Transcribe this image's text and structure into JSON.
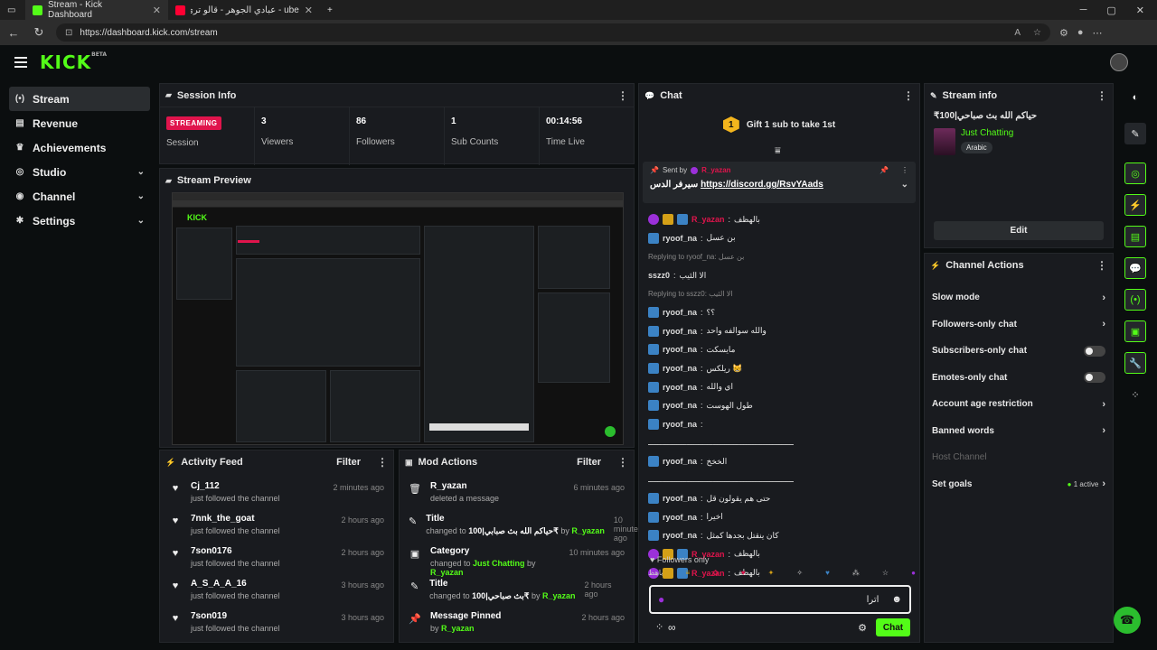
{
  "browser": {
    "tabs": [
      {
        "label": "Stream - Kick Dashboard",
        "color": "#53fc18"
      },
      {
        "label": "ube - عبادي الجوهر - قالو ترى (710)",
        "color": "#ff0033"
      }
    ],
    "url": "https://dashboard.kick.com/stream",
    "new_tab": "+",
    "win_controls": [
      "─",
      "▢",
      "✕"
    ]
  },
  "logo": {
    "text": "KICK",
    "beta": "BETA"
  },
  "sidebar": {
    "items": [
      {
        "label": "Stream",
        "icon": "stream-icon",
        "glyph": "(•)"
      },
      {
        "label": "Revenue",
        "icon": "revenue-icon",
        "glyph": "▤"
      },
      {
        "label": "Achievements",
        "icon": "trophy-icon",
        "glyph": "♛"
      },
      {
        "label": "Studio",
        "icon": "studio-icon",
        "glyph": "◎",
        "chev": "⌄"
      },
      {
        "label": "Channel",
        "icon": "channel-icon",
        "glyph": "◉",
        "chev": "⌄"
      },
      {
        "label": "Settings",
        "icon": "gear-icon",
        "glyph": "✱",
        "chev": "⌄"
      }
    ]
  },
  "session": {
    "title": "Session Info",
    "status_badge": "STREAMING",
    "status_label": "Session",
    "stats": [
      {
        "value": "3",
        "label": "Viewers"
      },
      {
        "value": "86",
        "label": "Followers"
      },
      {
        "value": "1",
        "label": "Sub Counts"
      },
      {
        "value": "00:14:56",
        "label": "Time Live"
      }
    ]
  },
  "preview": {
    "title": "Stream Preview",
    "logo": "KICK"
  },
  "activity": {
    "title": "Activity Feed",
    "filter": "Filter",
    "items": [
      {
        "name": "Cj_112",
        "desc": "just followed the channel",
        "time": "2 minutes ago"
      },
      {
        "name": "7nnk_the_goat",
        "desc": "just followed the channel",
        "time": "2 hours ago"
      },
      {
        "name": "7son0176",
        "desc": "just followed the channel",
        "time": "2 hours ago"
      },
      {
        "name": "A_S_A_A_16",
        "desc": "just followed the channel",
        "time": "3 hours ago"
      },
      {
        "name": "7son019",
        "desc": "just followed the channel",
        "time": "3 hours ago"
      }
    ]
  },
  "mod": {
    "title": "Mod Actions",
    "filter": "Filter",
    "items": [
      {
        "name": "R_yazan",
        "pre": "deleted a message",
        "hl": "",
        "mid": "",
        "by": "",
        "time": "6 minutes ago",
        "icon": "trash-icon",
        "glyph": "🗑"
      },
      {
        "name": "Title",
        "pre": "changed to ",
        "hl": "حياكم الله بث صبابي|100₹",
        "mid": " by ",
        "by": "R_yazan",
        "time": "10 minutes ago",
        "icon": "edit-title-icon",
        "glyph": "✎"
      },
      {
        "name": "Category",
        "pre": "changed to ",
        "hl": "Just Chatting",
        "mid": " by ",
        "by": "R_yazan",
        "time": "10 minutes ago",
        "icon": "category-icon",
        "glyph": "▣"
      },
      {
        "name": "Title",
        "pre": "changed to ",
        "hl": "بث صباحي|100₹",
        "mid": " by ",
        "by": "R_yazan",
        "time": "2 hours ago",
        "icon": "edit-title-icon",
        "glyph": "✎"
      },
      {
        "name": "Message Pinned",
        "pre": "by ",
        "hl": "R_yazan",
        "mid": "",
        "by": "",
        "time": "2 hours ago",
        "icon": "pin-icon",
        "glyph": "📌"
      }
    ]
  },
  "chat": {
    "title": "Chat",
    "gift_num": "1",
    "gift_text": "Gift 1 sub to take 1st",
    "pinned_by": "Sent by",
    "pinned_user": "R_yazan",
    "pinned_msg": "سيرفر الدس",
    "pinned_link": "https://discord.gg/RsvYAads",
    "messages": [
      {
        "user": "R_yazan",
        "text": "بالهظف",
        "badges": [
          "purple",
          "gold",
          "blue"
        ],
        "red": true
      },
      {
        "user": "ryoof_na",
        "text": "بن عسل",
        "badges": [
          "blue"
        ],
        "red": false
      },
      {
        "reply": "Replying to ryoof_na: بن عسل"
      },
      {
        "user": "sszz0",
        "text": "الا الئيب",
        "badges": [],
        "red": false
      },
      {
        "reply": "Replying to sszz0: الا الئيب"
      },
      {
        "user": "ryoof_na",
        "text": "؟؟",
        "badges": [
          "blue"
        ],
        "red": false
      },
      {
        "user": "ryoof_na",
        "text": "والله سوالفه واحد",
        "badges": [
          "blue"
        ],
        "red": false
      },
      {
        "user": "ryoof_na",
        "text": "مايسكت",
        "badges": [
          "blue"
        ],
        "red": false
      },
      {
        "user": "ryoof_na",
        "text": "ريلكس 😸",
        "badges": [
          "blue"
        ],
        "red": false
      },
      {
        "user": "ryoof_na",
        "text": "اي والله",
        "badges": [
          "blue"
        ],
        "red": false
      },
      {
        "user": "ryoof_na",
        "text": "طول الهوست",
        "badges": [
          "blue"
        ],
        "red": false
      },
      {
        "user": "ryoof_na",
        "text": "",
        "badges": [
          "blue"
        ],
        "red": false
      },
      {
        "line": "ـــــــــــــــــــــــــــــــــــــــــــــــــــــــــــــ"
      },
      {
        "user": "ryoof_na",
        "text": "الخخخ",
        "badges": [
          "blue"
        ],
        "red": false
      },
      {
        "line": "ـــــــــــــــــــــــــــــــــــــــــــــــــــــــــــــ"
      },
      {
        "user": "ryoof_na",
        "text": "حتى هم يقولون قل",
        "badges": [
          "blue"
        ],
        "red": false
      },
      {
        "user": "ryoof_na",
        "text": "اخيرا",
        "badges": [
          "blue"
        ],
        "red": false
      },
      {
        "user": "ryoof_na",
        "text": "كان ينقتل بجدها كمثل",
        "badges": [
          "blue"
        ],
        "red": false
      },
      {
        "user": "R_yazan",
        "text": "بالهظف",
        "badges": [
          "purple",
          "gold",
          "blue"
        ],
        "red": true
      },
      {
        "user": "R_yazan",
        "text": "بالهظف",
        "badges": [
          "purple",
          "gold",
          "blue"
        ],
        "red": true
      }
    ],
    "followers_only": "Followers only",
    "input_value": "اترا",
    "send_label": "Chat"
  },
  "stream_info": {
    "title": "Stream info",
    "stream_title": "حياكم الله بث صباحي|100₹",
    "category": "Just Chatting",
    "language": "Arabic",
    "edit_label": "Edit"
  },
  "channel_actions": {
    "title": "Channel Actions",
    "rows": [
      {
        "label": "Slow mode",
        "kind": "chev"
      },
      {
        "label": "Followers-only chat",
        "kind": "chev"
      },
      {
        "label": "Subscribers-only chat",
        "kind": "toggle"
      },
      {
        "label": "Emotes-only chat",
        "kind": "toggle"
      },
      {
        "label": "Account age restriction",
        "kind": "chev"
      },
      {
        "label": "Banned words",
        "kind": "chev"
      },
      {
        "label": "Host Channel",
        "kind": "dim"
      },
      {
        "label": "Set goals",
        "kind": "goals",
        "extra": "1 active"
      }
    ]
  },
  "colors": {
    "accent": "#53fc18",
    "live": "#e0144c"
  }
}
